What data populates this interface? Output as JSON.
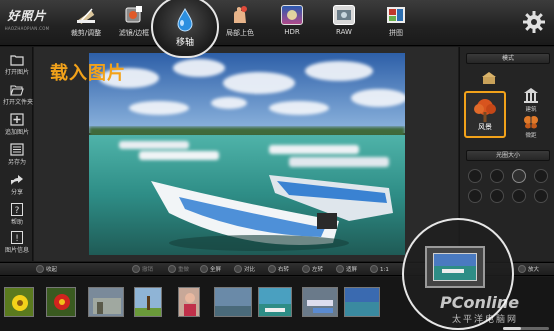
{
  "app": {
    "logo_text": "好照片",
    "logo_sub": "HAOZHAOPIAN.COM"
  },
  "toolbar": {
    "tools": [
      {
        "label": "裁剪/调整",
        "icon": "crop-ruler-icon"
      },
      {
        "label": "滤镜/边框",
        "icon": "filter-frame-icon"
      },
      {
        "label": "移轴",
        "icon": "water-drop-icon"
      },
      {
        "label": "局部上色",
        "icon": "hand-color-icon"
      },
      {
        "label": "HDR",
        "icon": "hdr-icon"
      },
      {
        "label": "RAW",
        "icon": "raw-icon"
      },
      {
        "label": "拼图",
        "icon": "collage-icon"
      }
    ],
    "settings_icon": "gear-icon"
  },
  "sidebar": {
    "items": [
      {
        "label": "打开图片",
        "icon": "folder-icon"
      },
      {
        "label": "打开文件夹",
        "icon": "folder-open-icon"
      },
      {
        "label": "追加图片",
        "icon": "add-image-icon"
      },
      {
        "label": "另存为",
        "icon": "save-as-icon"
      },
      {
        "label": "分享",
        "icon": "share-icon"
      },
      {
        "label": "帮助",
        "icon": "help-icon"
      },
      {
        "label": "图片信息",
        "icon": "info-icon"
      }
    ]
  },
  "canvas": {
    "heading": "载入图片"
  },
  "right_panel": {
    "mode_title": "模式",
    "modes": [
      {
        "label": "风景",
        "icon": "tree-icon",
        "selected": true
      },
      {
        "label": "建筑",
        "icon": "building-icon"
      },
      {
        "label": "微距",
        "icon": "butterfly-icon"
      }
    ],
    "aperture_title": "光圈大小"
  },
  "controls": {
    "collapse": "收起",
    "rotate_left": "撤销",
    "rotate_right": "重做",
    "fullscreen": "全屏",
    "compare": "对比",
    "rotate_cw": "右转",
    "rotate_ccw": "左转",
    "fit": "适屏",
    "ratio": "1:1",
    "expand": "放大"
  },
  "watermark": {
    "line1": "PConline",
    "line2": "太平洋电脑网"
  },
  "colors": {
    "accent": "#f2a21a",
    "sea": "#2e8d86",
    "sky": "#3a6fb5"
  }
}
